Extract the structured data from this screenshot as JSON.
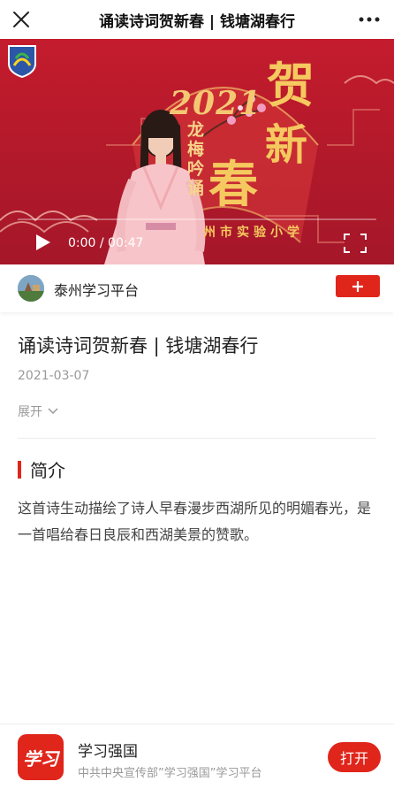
{
  "header": {
    "title": "诵读诗词贺新春 | 钱塘湖春行",
    "close_icon": "close-icon",
    "more_icon": "more-icon"
  },
  "video": {
    "year": "2021",
    "vertical_text": "龙梅吟诵",
    "big_chars": [
      "贺",
      "新",
      "春"
    ],
    "school": "州市实验小学",
    "time": "0:00 / 00:47",
    "progress": 0,
    "play_icon": "play-icon",
    "fullscreen_icon": "fullscreen-icon"
  },
  "channel": {
    "name": "泰州学习平台",
    "follow_icon": "plus-icon"
  },
  "article": {
    "title": "诵读诗词贺新春 | 钱塘湖春行",
    "date": "2021-03-07",
    "expand_label": "展开"
  },
  "intro": {
    "heading": "简介",
    "text": "这首诗生动描绘了诗人早春漫步西湖所见的明媚春光，是一首唱给春日良辰和西湖美景的赞歌。"
  },
  "app_banner": {
    "logo_text": "学习",
    "name": "学习强国",
    "description": "中共中央宣传部”学习强国”学习平台",
    "open_label": "打开"
  },
  "colors": {
    "accent": "#e0251b",
    "video_bg": "#b1192a",
    "gold": "#f5c95f"
  }
}
